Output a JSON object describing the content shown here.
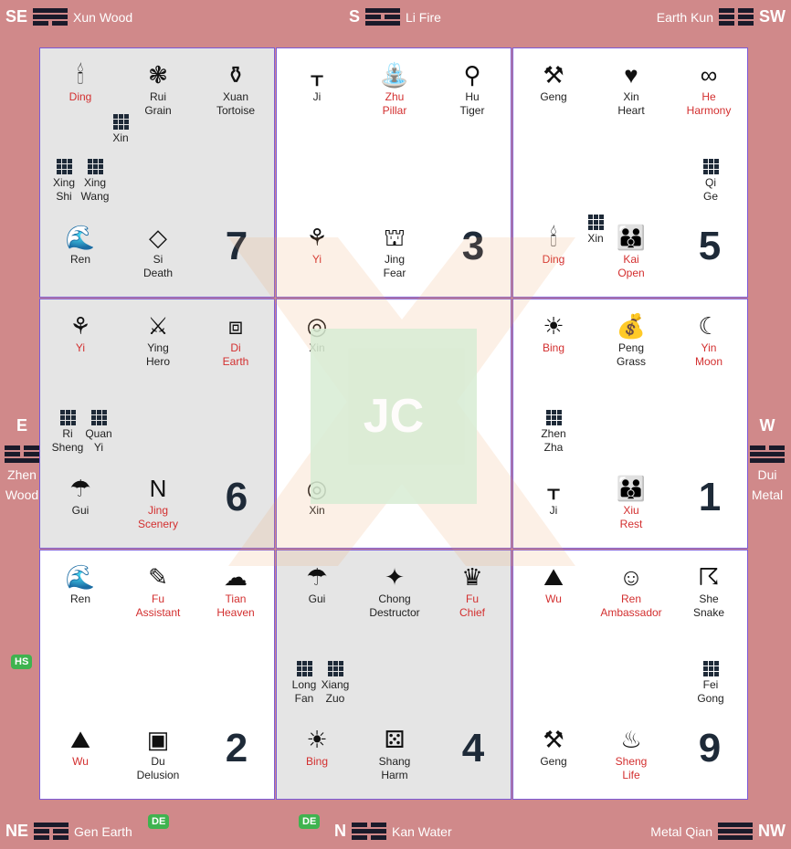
{
  "edges": {
    "se": {
      "dir": "SE",
      "label": "Xun Wood"
    },
    "s": {
      "dir": "S",
      "label": "Li Fire"
    },
    "sw": {
      "dir": "SW",
      "label": "Earth Kun"
    },
    "e": {
      "dir": "E",
      "l1": "Zhen",
      "l2": "Wood"
    },
    "w": {
      "dir": "W",
      "l1": "Dui",
      "l2": "Metal"
    },
    "ne": {
      "dir": "NE",
      "label": "Gen Earth"
    },
    "n": {
      "dir": "N",
      "label": "Kan Water"
    },
    "nw": {
      "dir": "NW",
      "label": "Metal Qian"
    }
  },
  "badges": {
    "hs": "HS",
    "de1": "DE",
    "de2": "DE"
  },
  "center": {
    "logo": "JC"
  },
  "palaces": [
    {
      "number": "7",
      "items": [
        {
          "icon": "candle-icon",
          "l1": "Ding",
          "l2": "",
          "color": "red"
        },
        {
          "icon": "grain-icon",
          "l1": "Rui",
          "l2": "Grain",
          "color": "blk"
        },
        {
          "icon": "tortoise-icon",
          "l1": "Xuan",
          "l2": "Tortoise",
          "color": "blk"
        },
        {
          "icon": "wave-icon",
          "l1": "Ren",
          "l2": "",
          "color": "blk"
        },
        {
          "icon": "dead-end-icon",
          "l1": "Si",
          "l2": "Death",
          "color": "blk"
        }
      ],
      "stars": [
        {
          "l1": "Xin",
          "l2": ""
        },
        {
          "l1": "Xing",
          "l2": "Shi"
        },
        {
          "l1": "Xing",
          "l2": "Wang"
        }
      ]
    },
    {
      "number": "3",
      "items": [
        {
          "icon": "grass-icon",
          "l1": "Ji",
          "l2": "",
          "color": "blk"
        },
        {
          "icon": "fountain-icon",
          "l1": "Zhu",
          "l2": "Pillar",
          "color": "red"
        },
        {
          "icon": "tiger-icon",
          "l1": "Hu",
          "l2": "Tiger",
          "color": "blk"
        },
        {
          "icon": "sprout-icon",
          "l1": "Yi",
          "l2": "",
          "color": "red"
        },
        {
          "icon": "haunted-house-icon",
          "l1": "Jing",
          "l2": "Fear",
          "color": "blk"
        }
      ],
      "stars": []
    },
    {
      "number": "5",
      "items": [
        {
          "icon": "chainsaw-icon",
          "l1": "Geng",
          "l2": "",
          "color": "blk"
        },
        {
          "icon": "heart-icon",
          "l1": "Xin",
          "l2": "Heart",
          "color": "blk"
        },
        {
          "icon": "rings-icon",
          "l1": "He",
          "l2": "Harmony",
          "color": "red"
        },
        {
          "icon": "candle-icon",
          "l1": "Ding",
          "l2": "",
          "color": "red"
        },
        {
          "icon": "family-icon",
          "l1": "Kai",
          "l2": "Open",
          "color": "red"
        }
      ],
      "stars": [
        {
          "l1": "Qi",
          "l2": "Ge"
        },
        {
          "l1": "Xin",
          "l2": ""
        }
      ]
    },
    {
      "number": "6",
      "items": [
        {
          "icon": "sprout-icon",
          "l1": "Yi",
          "l2": "",
          "color": "red"
        },
        {
          "icon": "hero-icon",
          "l1": "Ying",
          "l2": "Hero",
          "color": "blk"
        },
        {
          "icon": "box-icon",
          "l1": "Di",
          "l2": "Earth",
          "color": "red"
        },
        {
          "icon": "rain-cloud-icon",
          "l1": "Gui",
          "l2": "",
          "color": "blk"
        },
        {
          "icon": "n-sign-icon",
          "l1": "Jing",
          "l2": "Scenery",
          "color": "red"
        }
      ],
      "stars": [
        {
          "l1": "Ri",
          "l2": "Sheng"
        },
        {
          "l1": "Quan",
          "l2": "Yi"
        }
      ]
    },
    {
      "number": "",
      "items": [
        {
          "icon": "ring-icon",
          "l1": "Xin",
          "l2": "",
          "color": "blk"
        },
        {
          "icon": "ring-icon",
          "l1": "Xin",
          "l2": "",
          "color": "blk"
        }
      ],
      "stars": []
    },
    {
      "number": "1",
      "items": [
        {
          "icon": "sun-icon",
          "l1": "Bing",
          "l2": "",
          "color": "red"
        },
        {
          "icon": "money-bag-icon",
          "l1": "Peng",
          "l2": "Grass",
          "color": "blk"
        },
        {
          "icon": "moon-icon",
          "l1": "Yin",
          "l2": "Moon",
          "color": "red"
        },
        {
          "icon": "grass-icon",
          "l1": "Ji",
          "l2": "",
          "color": "blk"
        },
        {
          "icon": "family-icon",
          "l1": "Xiu",
          "l2": "Rest",
          "color": "red"
        }
      ],
      "stars": [
        {
          "l1": "Zhen",
          "l2": "Zha"
        }
      ]
    },
    {
      "number": "2",
      "items": [
        {
          "icon": "wave-icon",
          "l1": "Ren",
          "l2": "",
          "color": "blk"
        },
        {
          "icon": "assistant-icon",
          "l1": "Fu",
          "l2": "Assistant",
          "color": "red"
        },
        {
          "icon": "heaven-icon",
          "l1": "Tian",
          "l2": "Heaven",
          "color": "red"
        },
        {
          "icon": "mountain-icon",
          "l1": "Wu",
          "l2": "",
          "color": "red"
        },
        {
          "icon": "close-sign-icon",
          "l1": "Du",
          "l2": "Delusion",
          "color": "blk"
        }
      ],
      "stars": []
    },
    {
      "number": "4",
      "items": [
        {
          "icon": "rain-cloud-icon",
          "l1": "Gui",
          "l2": "",
          "color": "blk"
        },
        {
          "icon": "destructor-icon",
          "l1": "Chong",
          "l2": "Destructor",
          "color": "blk"
        },
        {
          "icon": "crown-icon",
          "l1": "Fu",
          "l2": "Chief",
          "color": "red"
        },
        {
          "icon": "sun-icon",
          "l1": "Bing",
          "l2": "",
          "color": "red"
        },
        {
          "icon": "dice-icon",
          "l1": "Shang",
          "l2": "Harm",
          "color": "blk"
        }
      ],
      "stars": [
        {
          "l1": "Long",
          "l2": "Fan"
        },
        {
          "l1": "Xiang",
          "l2": "Zuo"
        }
      ]
    },
    {
      "number": "9",
      "items": [
        {
          "icon": "mountain-icon",
          "l1": "Wu",
          "l2": "",
          "color": "red"
        },
        {
          "icon": "ambassador-icon",
          "l1": "Ren",
          "l2": "Ambassador",
          "color": "red"
        },
        {
          "icon": "snake-icon",
          "l1": "She",
          "l2": "Snake",
          "color": "blk"
        },
        {
          "icon": "chainsaw-icon",
          "l1": "Geng",
          "l2": "",
          "color": "blk"
        },
        {
          "icon": "cauldron-icon",
          "l1": "Sheng",
          "l2": "Life",
          "color": "red"
        }
      ],
      "stars": [
        {
          "l1": "Fei",
          "l2": "Gong"
        }
      ]
    }
  ]
}
